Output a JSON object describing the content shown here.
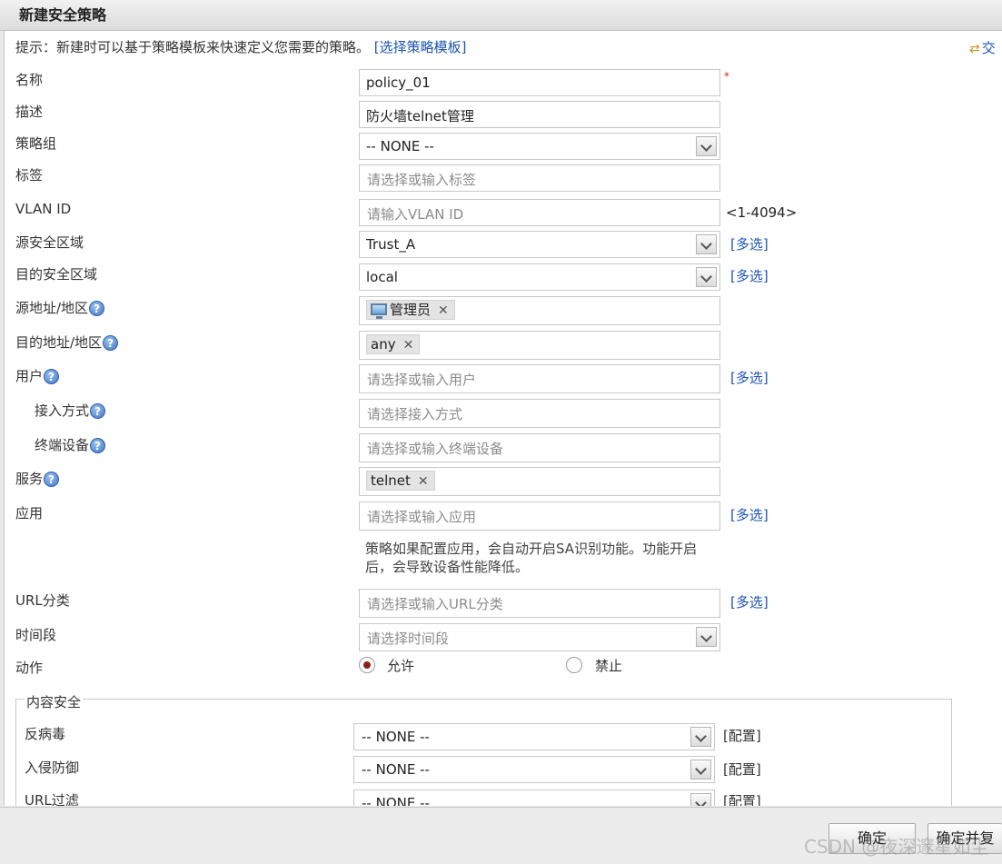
{
  "dialog": {
    "title": "新建安全策略"
  },
  "hint": {
    "text": "提示：新建时可以基于策略模板来快速定义您需要的策略。",
    "link": "[选择策略模板]"
  },
  "top_right_link": "交",
  "form": {
    "name": {
      "label": "名称",
      "value": "policy_01",
      "required_mark": "*"
    },
    "description": {
      "label": "描述",
      "value": "防火墙telnet管理"
    },
    "policy_group": {
      "label": "策略组",
      "value": "-- NONE --"
    },
    "tags": {
      "label": "标签",
      "placeholder": "请选择或输入标签"
    },
    "vlan": {
      "label": "VLAN ID",
      "placeholder": "请输入VLAN ID",
      "range": "<1-4094>"
    },
    "src_zone": {
      "label": "源安全区域",
      "value": "Trust_A",
      "multi": "[多选]"
    },
    "dst_zone": {
      "label": "目的安全区域",
      "value": "local",
      "multi": "[多选]"
    },
    "src_addr": {
      "label": "源地址/地区",
      "tag": "管理员"
    },
    "dst_addr": {
      "label": "目的地址/地区",
      "tag": "any"
    },
    "user": {
      "label": "用户",
      "placeholder": "请选择或输入用户",
      "multi": "[多选]"
    },
    "access_mode": {
      "label": "接入方式",
      "placeholder": "请选择接入方式"
    },
    "terminal": {
      "label": "终端设备",
      "placeholder": "请选择或输入终端设备"
    },
    "service": {
      "label": "服务",
      "tag": "telnet"
    },
    "application": {
      "label": "应用",
      "placeholder": "请选择或输入应用",
      "multi": "[多选]",
      "note_line1": "策略如果配置应用，会自动开启SA识别功能。功能开启",
      "note_line2": "后，会导致设备性能降低。"
    },
    "url_category": {
      "label": "URL分类",
      "placeholder": "请选择或输入URL分类",
      "multi": "[多选]"
    },
    "time_range": {
      "label": "时间段",
      "placeholder": "请选择时间段"
    },
    "action": {
      "label": "动作",
      "allow": "允许",
      "deny": "禁止"
    }
  },
  "content_security": {
    "legend": "内容安全",
    "antivirus": {
      "label": "反病毒",
      "value": "-- NONE --",
      "config": "[配置]"
    },
    "ips": {
      "label": "入侵防御",
      "value": "-- NONE --",
      "config": "[配置]"
    },
    "url_filter": {
      "label": "URL过滤",
      "value": "-- NONE --",
      "config": "[配置]"
    }
  },
  "footer": {
    "ok": "确定",
    "ok_and_copy": "确定并复",
    "watermark": "CSDN @夜深邃星如尘"
  },
  "icons": {
    "help": "?",
    "remove": "✕",
    "swap": "⇄"
  }
}
